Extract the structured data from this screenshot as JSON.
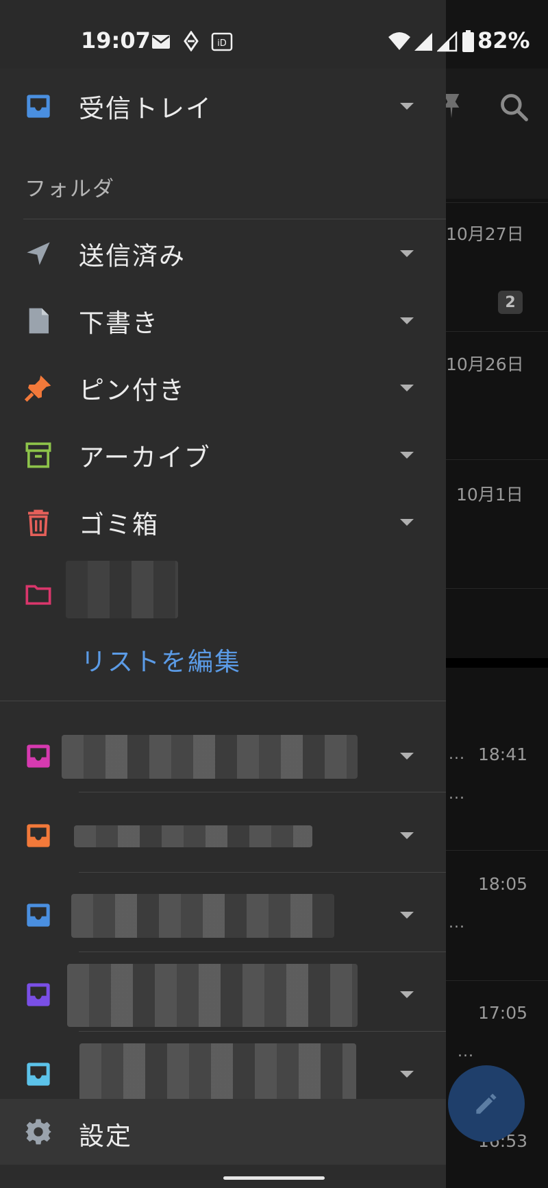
{
  "status_bar": {
    "time": "19:07",
    "icons": [
      "mail-icon",
      "swap-icon",
      "id-icon",
      "wifi-icon",
      "signal-icon",
      "signal-icon-2",
      "battery-icon"
    ],
    "battery": "82%"
  },
  "drawer": {
    "inbox": {
      "label": "受信トレイ",
      "icon": "inbox-icon",
      "color": "#4a8fe0"
    },
    "folders_title": "フォルダ",
    "folders": [
      {
        "label": "送信済み",
        "icon": "send-icon",
        "color": "#9aa3ad"
      },
      {
        "label": "下書き",
        "icon": "draft-icon",
        "color": "#9aa3ad"
      },
      {
        "label": "ピン付き",
        "icon": "pin-icon",
        "color": "#f2793a"
      },
      {
        "label": "アーカイブ",
        "icon": "archive-icon",
        "color": "#8dc34a"
      },
      {
        "label": "ゴミ箱",
        "icon": "trash-icon",
        "color": "#e5605a"
      }
    ],
    "custom_folder": {
      "icon": "folder-icon",
      "color": "#d9366b"
    },
    "edit_list": "リストを編集",
    "accounts": [
      {
        "icon": "inbox-icon",
        "color": "#d63ab0"
      },
      {
        "icon": "inbox-icon",
        "color": "#f2793a"
      },
      {
        "icon": "inbox-icon",
        "color": "#4a8fe0"
      },
      {
        "icon": "inbox-icon",
        "color": "#7a4fe6"
      },
      {
        "icon": "inbox-icon",
        "color": "#5cc3ea"
      }
    ],
    "settings": "設定"
  },
  "background": {
    "dates": [
      "10月27日",
      "10月26日",
      "10月1日"
    ],
    "unread_badge": "2",
    "times": [
      "18:41",
      "18:05",
      "17:05",
      "16:53"
    ],
    "ellipsis": "..."
  }
}
